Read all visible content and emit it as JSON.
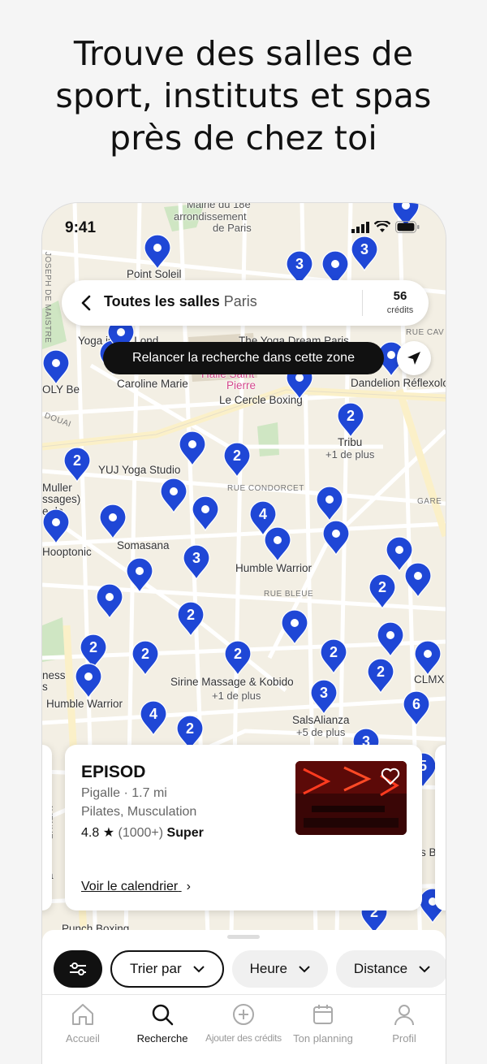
{
  "headline": [
    "Trouve des salles de",
    "sport, instituts et spas",
    "près de chez toi"
  ],
  "status_bar": {
    "time": "9:41"
  },
  "search": {
    "title": "Toutes les salles",
    "city": "Paris",
    "credits_value": "56",
    "credits_label": "crédits"
  },
  "map": {
    "relaunch_label": "Relancer la recherche dans cette zone",
    "area_labels": [
      "Mairie du 18e",
      "arrondissement",
      "de Paris"
    ],
    "place_labels": [
      "Point Soleil",
      "Yoga is My Lond",
      "The Yoga Dream Paris",
      "Caroline Marie",
      "Halle Saint",
      "Pierre",
      "Dandelion Réflexolog",
      "OLY Be",
      "Le Cercle Boxing",
      "Tribu",
      "+1 de plus",
      "YUJ Yoga Studio",
      "Muller",
      "ssages)",
      "e de",
      "Somasana",
      "Hooptonic",
      "Humble Warrior",
      "ness",
      "s",
      "Humble Warrior",
      "Sirine Massage & Kobido",
      "+1 de plus",
      "SalsAlianza",
      "+5 de plus",
      "CLMX",
      "ila",
      "e",
      "s B",
      "Punch Boxing"
    ],
    "street_labels": [
      "JOSEPH DE MAISTRE",
      "DOUAI",
      "RUE CONDORCET",
      "RUE BLEUE",
      "RUE CAV",
      "GARE",
      "AVENUE"
    ],
    "pin_counts": [
      "3",
      "3",
      "2",
      "2",
      "2",
      "4",
      "3",
      "2",
      "2",
      "2",
      "2",
      "2",
      "2",
      "2",
      "3",
      "6",
      "4",
      "2",
      "3",
      "5",
      "2",
      "2"
    ]
  },
  "venue_card": {
    "name": "EPISOD",
    "location": "Pigalle · 1.7 mi",
    "categories": "Pilates, Musculation",
    "rating": "4.8",
    "reviews": "(1000+)",
    "quality": "Super",
    "calendar_link": "Voir le calendrier"
  },
  "filters": {
    "sort": "Trier par",
    "time": "Heure",
    "distance": "Distance"
  },
  "tabs": [
    "Accueil",
    "Recherche",
    "Ajouter des crédits",
    "Ton planning",
    "Profil"
  ],
  "colors": {
    "pin": "#1f47d6",
    "accent": "#111111",
    "map_bg": "#f3efe4",
    "park": "#cfe6c3"
  }
}
